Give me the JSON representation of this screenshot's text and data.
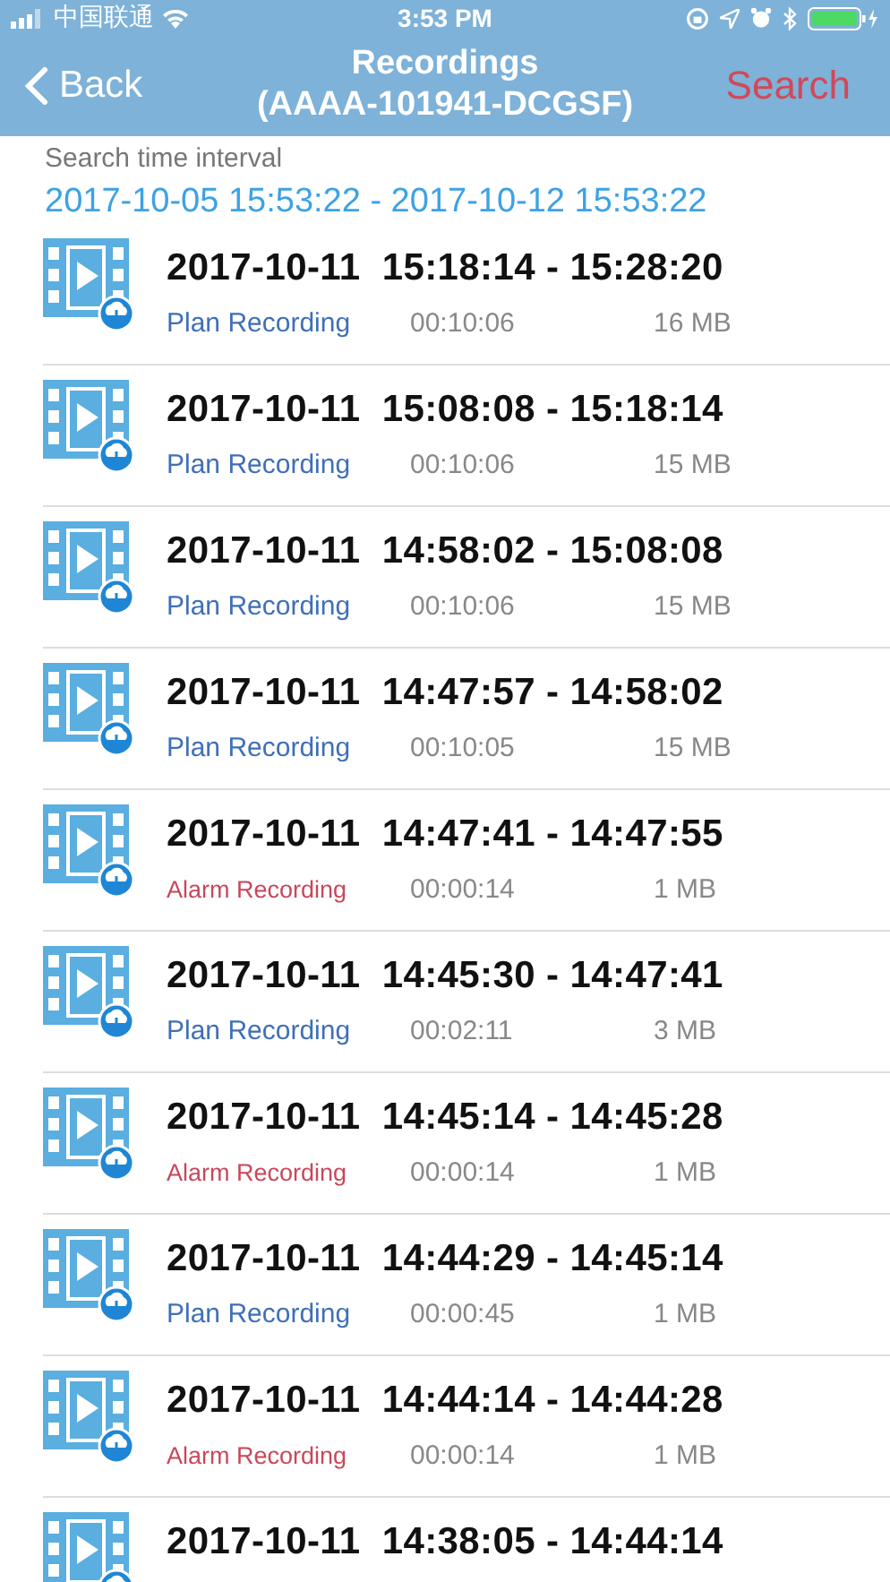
{
  "status_bar": {
    "carrier": "中国联通",
    "time": "3:53 PM"
  },
  "nav": {
    "back": "Back",
    "title": "Recordings",
    "subtitle": "(AAAA-101941-DCGSF)",
    "action": "Search"
  },
  "search_interval": {
    "label": "Search time interval",
    "value": "2017-10-05 15:53:22 - 2017-10-12 15:53:22"
  },
  "recordings": [
    {
      "time": "2017-10-11  15:18:14 - 15:28:20",
      "kind": "plan",
      "type": "Plan Recording",
      "duration": "00:10:06",
      "size": "16 MB"
    },
    {
      "time": "2017-10-11  15:08:08 - 15:18:14",
      "kind": "plan",
      "type": "Plan Recording",
      "duration": "00:10:06",
      "size": "15 MB"
    },
    {
      "time": "2017-10-11  14:58:02 - 15:08:08",
      "kind": "plan",
      "type": "Plan Recording",
      "duration": "00:10:06",
      "size": "15 MB"
    },
    {
      "time": "2017-10-11  14:47:57 - 14:58:02",
      "kind": "plan",
      "type": "Plan Recording",
      "duration": "00:10:05",
      "size": "15 MB"
    },
    {
      "time": "2017-10-11  14:47:41 - 14:47:55",
      "kind": "alarm",
      "type": "Alarm Recording",
      "duration": "00:00:14",
      "size": "1 MB"
    },
    {
      "time": "2017-10-11  14:45:30 - 14:47:41",
      "kind": "plan",
      "type": "Plan Recording",
      "duration": "00:02:11",
      "size": "3 MB"
    },
    {
      "time": "2017-10-11  14:45:14 - 14:45:28",
      "kind": "alarm",
      "type": "Alarm Recording",
      "duration": "00:00:14",
      "size": "1 MB"
    },
    {
      "time": "2017-10-11  14:44:29 - 14:45:14",
      "kind": "plan",
      "type": "Plan Recording",
      "duration": "00:00:45",
      "size": "1 MB"
    },
    {
      "time": "2017-10-11  14:44:14 - 14:44:28",
      "kind": "alarm",
      "type": "Alarm Recording",
      "duration": "00:00:14",
      "size": "1 MB"
    },
    {
      "time": "2017-10-11  14:38:05 - 14:44:14"
    }
  ]
}
